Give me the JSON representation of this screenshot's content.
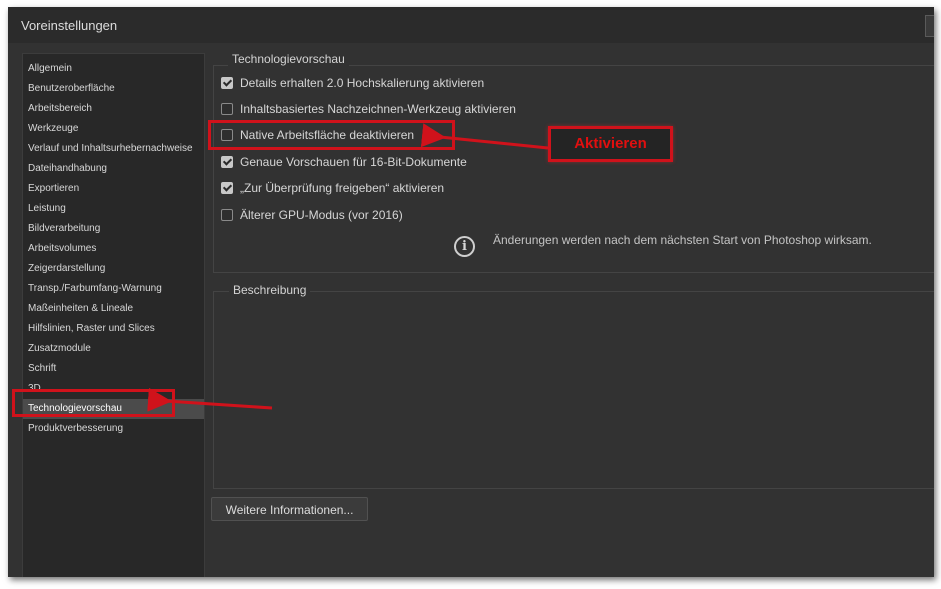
{
  "dialog": {
    "title": "Voreinstellungen"
  },
  "sidebar": {
    "items": [
      {
        "label": "Allgemein"
      },
      {
        "label": "Benutzeroberfläche"
      },
      {
        "label": "Arbeitsbereich"
      },
      {
        "label": "Werkzeuge"
      },
      {
        "label": "Verlauf und Inhaltsurhebernachweise"
      },
      {
        "label": "Dateihandhabung"
      },
      {
        "label": "Exportieren"
      },
      {
        "label": "Leistung"
      },
      {
        "label": "Bildverarbeitung"
      },
      {
        "label": "Arbeitsvolumes"
      },
      {
        "label": "Zeigerdarstellung"
      },
      {
        "label": "Transp./Farbumfang-Warnung"
      },
      {
        "label": "Maßeinheiten & Lineale"
      },
      {
        "label": "Hilfslinien, Raster und Slices"
      },
      {
        "label": "Zusatzmodule"
      },
      {
        "label": "Schrift"
      },
      {
        "label": "3D"
      },
      {
        "label": "Technologievorschau",
        "selected": true
      },
      {
        "label": "Produktverbesserung"
      }
    ]
  },
  "tech_preview": {
    "heading": "Technologievorschau",
    "options": [
      {
        "label": "Details erhalten 2.0 Hochskalierung aktivieren",
        "checked": true
      },
      {
        "label": "Inhaltsbasiertes Nachzeichnen-Werkzeug aktivieren",
        "checked": false
      },
      {
        "label": "Native Arbeitsfläche deaktivieren",
        "checked": false
      },
      {
        "label": "Genaue Vorschauen für 16-Bit-Dokumente",
        "checked": true
      },
      {
        "label": "„Zur Überprüfung freigeben“ aktivieren",
        "checked": true
      },
      {
        "label": "Älterer GPU-Modus (vor 2016)",
        "checked": false
      }
    ],
    "info_text": "Änderungen werden nach dem nächsten Start von Photoshop wirksam."
  },
  "description": {
    "heading": "Beschreibung"
  },
  "more_info_button": "Weitere Informationen...",
  "annotation": {
    "callout_text": "Aktivieren",
    "color": "#d0121b"
  }
}
